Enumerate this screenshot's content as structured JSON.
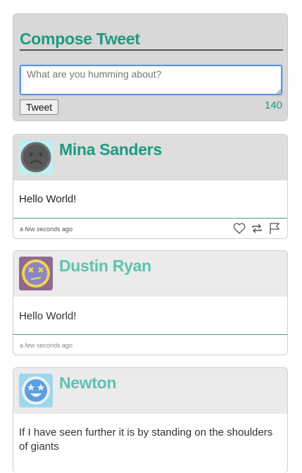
{
  "compose": {
    "title": "Compose Tweet",
    "placeholder": "What are you humming about?",
    "button_label": "Tweet",
    "char_count": "140"
  },
  "tweets": [
    {
      "author": "Mina Sanders",
      "text": "Hello World!",
      "time": "a few seconds ago",
      "highlighted": true,
      "avatar_icon": "frown-face-icon",
      "actions": [
        "heart-icon",
        "retweet-icon",
        "flag-icon"
      ]
    },
    {
      "author": "Dustin Ryan",
      "text": "Hello World!",
      "time": "a few seconds ago",
      "highlighted": false,
      "avatar_icon": "dizzy-face-icon"
    },
    {
      "author": "Newton",
      "text": "If I have seen further it is by standing on the shoulders of giants",
      "highlighted": false,
      "avatar_icon": "star-eyes-face-icon"
    }
  ],
  "colors": {
    "accent": "#1d9a80",
    "accent_light": "#5cc4ad",
    "focus_border": "#5a94e0"
  }
}
